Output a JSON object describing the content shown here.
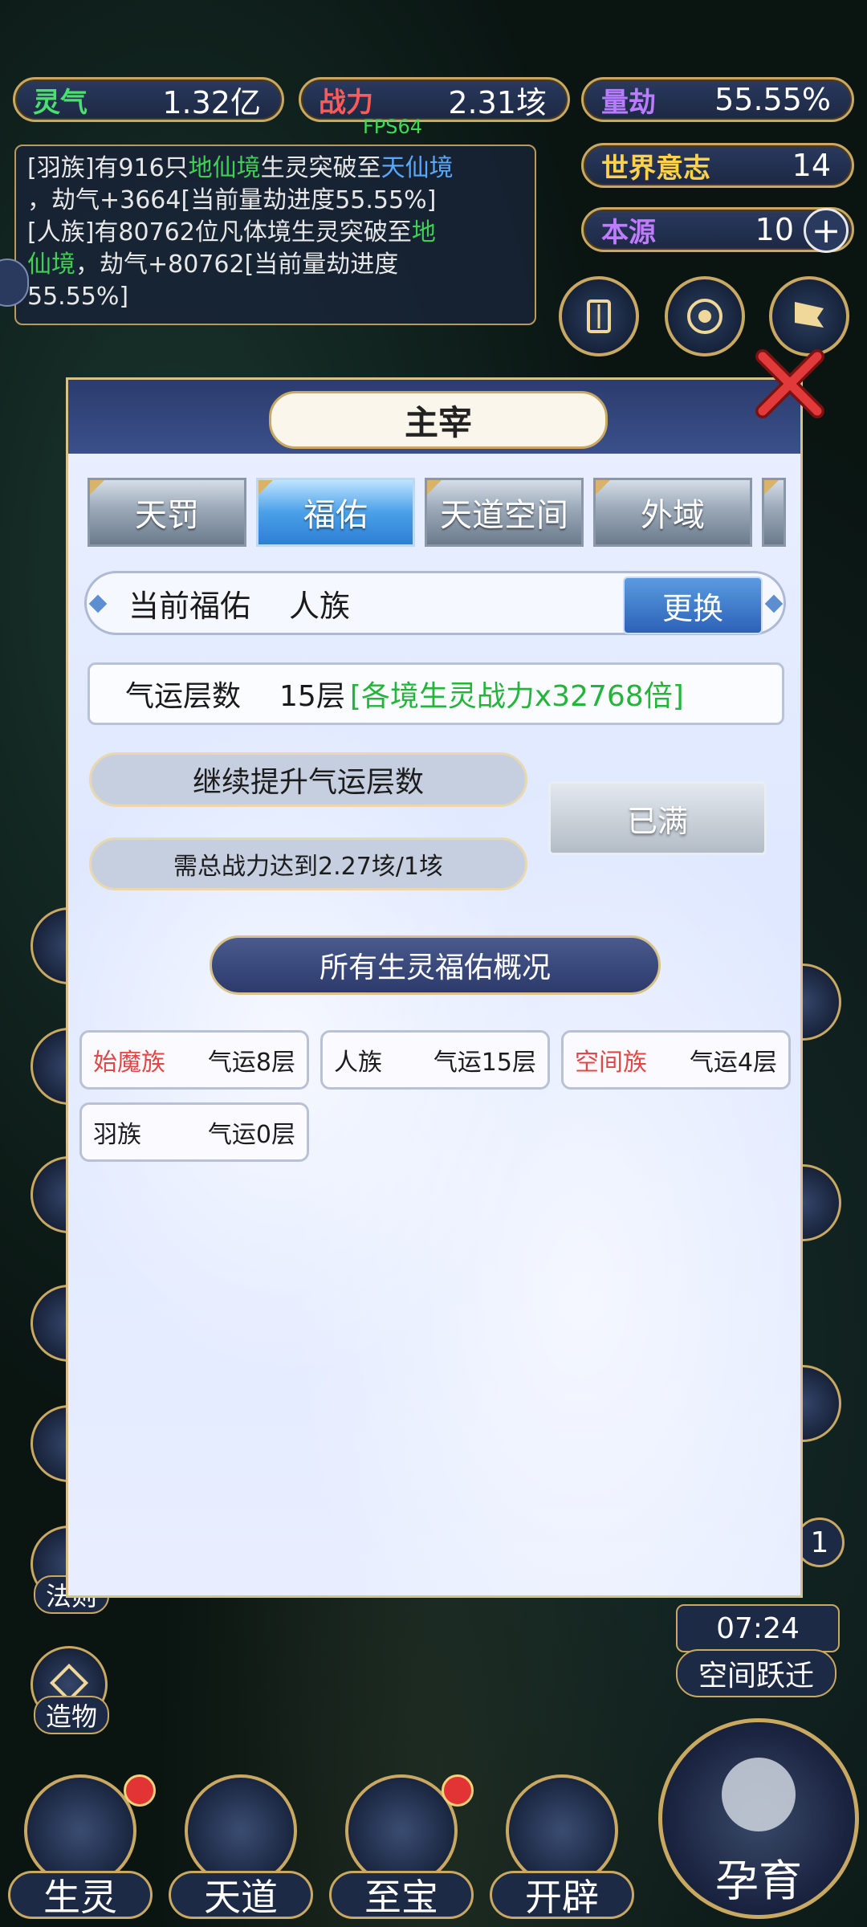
{
  "stats": {
    "lingqi": {
      "label": "灵气",
      "value": "1.32亿"
    },
    "zhanli": {
      "label": "战力",
      "value": "2.31垓"
    },
    "liangjie": {
      "label": "量劫",
      "value": "55.55%"
    },
    "shijie": {
      "label": "世界意志",
      "value": "14"
    },
    "benyuan": {
      "label": "本源",
      "value": "10"
    }
  },
  "fps": "FPS64",
  "log": {
    "line1_a": "[羽族]有916只",
    "line1_b": "地仙境",
    "line1_c": "生灵突破至",
    "line1_d": "天仙境",
    "line2": "，劫气+3664[当前量劫进度55.55%]",
    "line3_a": "[人族]有80762位凡体境生灵突破至",
    "line3_b": "地",
    "line4_a": "仙境",
    "line4_b": "，劫气+80762[当前量劫进度",
    "line5": "55.55%]"
  },
  "dialog": {
    "title": "主宰",
    "tabs": [
      "天罚",
      "福佑",
      "天道空间",
      "外域"
    ],
    "current_label": "当前福佑",
    "current_value": "人族",
    "change_label": "更换",
    "luck_label": "气运层数",
    "luck_value": "15层",
    "luck_bonus": "[各境生灵战力x32768倍]",
    "upgrade_label": "继续提升气运层数",
    "requirement": "需总战力达到2.27垓/1垓",
    "full_label": "已满",
    "overview_title": "所有生灵福佑概况",
    "races": [
      {
        "name": "始魔族",
        "luck": "气运8层",
        "highlight": true
      },
      {
        "name": "人族",
        "luck": "气运15层",
        "highlight": false
      },
      {
        "name": "空间族",
        "luck": "气运4层",
        "highlight": true
      },
      {
        "name": "羽族",
        "luck": "气运0层",
        "highlight": false
      }
    ]
  },
  "side": {
    "fa_ze": "法则",
    "zao_wu": "造物",
    "time": "07:24",
    "jump": "空间跃迁",
    "badge_count": "1"
  },
  "bottom_nav": {
    "sheng_ling": "生灵",
    "tian_dao": "天道",
    "zhi_bao": "至宝",
    "kai_pi": "开辟",
    "yun_yu": "孕育"
  }
}
